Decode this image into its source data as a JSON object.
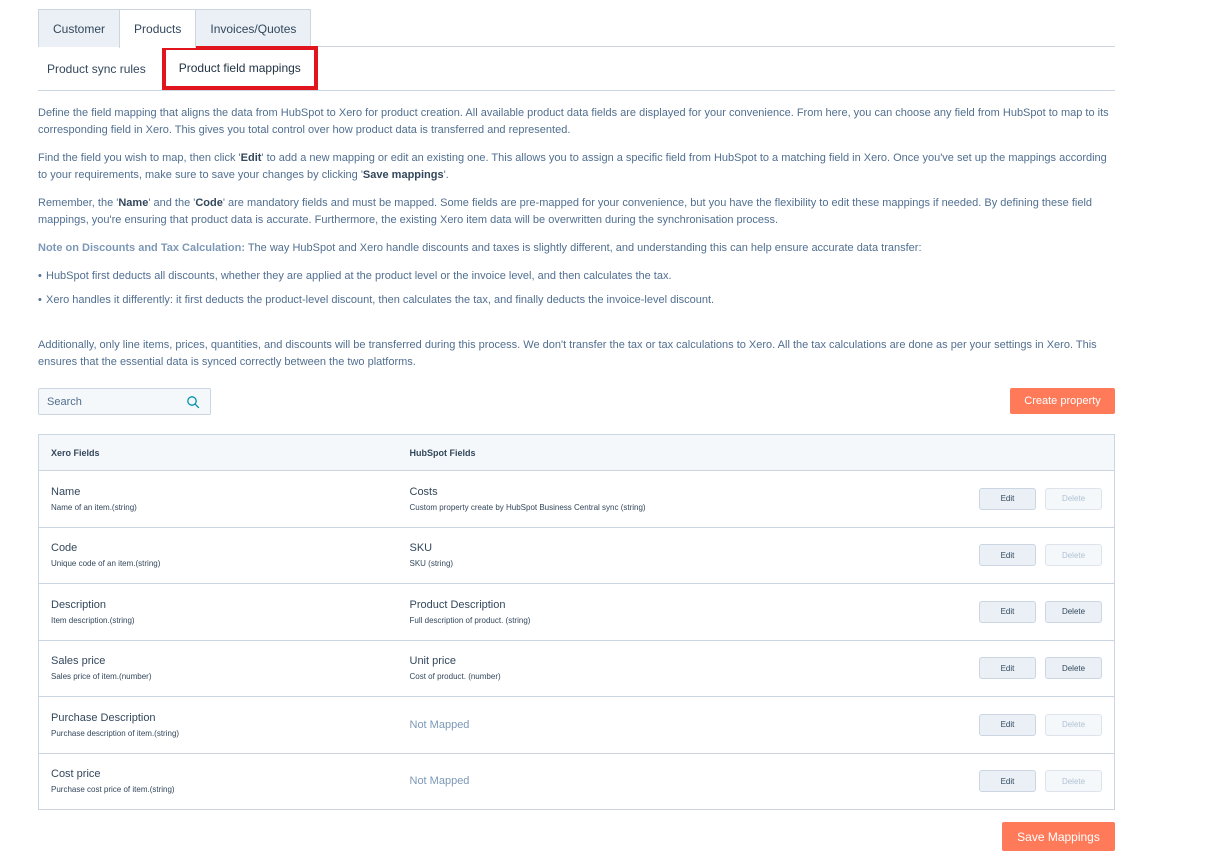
{
  "top_tabs": [
    {
      "label": "Customer",
      "active": false
    },
    {
      "label": "Products",
      "active": true
    },
    {
      "label": "Invoices/Quotes",
      "active": false
    }
  ],
  "sub_tabs": [
    {
      "label": "Product sync rules",
      "active": false
    },
    {
      "label": "Product field mappings",
      "active": true
    }
  ],
  "description": {
    "p1": "Define the field mapping that aligns the data from HubSpot to Xero for product creation. All available product data fields are displayed for your convenience. From here, you can choose any field from HubSpot to map to its corresponding field in Xero. This gives you total control over how product data is transferred and represented.",
    "p2_a": "Find the field you wish to map, then click '",
    "p2_edit": "Edit",
    "p2_b": "' to add a new mapping or edit an existing one. This allows you to assign a specific field from HubSpot to a matching field in Xero. Once you've set up the mappings according to your requirements, make sure to save your changes by clicking '",
    "p2_save": "Save mappings",
    "p2_c": "'.",
    "p3_a": "Remember, the '",
    "p3_name": "Name",
    "p3_b": "' and the '",
    "p3_code": "Code",
    "p3_c": "' are mandatory fields and must be mapped. Some fields are pre-mapped for your convenience, but you have the flexibility to edit these mappings if needed. By defining these field mappings, you're ensuring that product data is accurate.  Furthermore, the existing Xero item data will be overwritten during the synchronisation process.",
    "note_title": "Note on Discounts and Tax Calculation:",
    "note_text": " The way HubSpot and Xero handle discounts and taxes is slightly different, and understanding this can help ensure accurate data transfer:",
    "bullets": [
      "HubSpot first deducts all discounts, whether they are applied at the product level or the invoice level, and then calculates the tax.",
      "Xero handles it differently: it first deducts the product-level discount, then calculates the tax, and finally deducts the invoice-level discount."
    ],
    "p4": "Additionally, only line items, prices, quantities, and discounts will be transferred during this process. We don't transfer the tax or tax calculations to Xero. All the tax calculations are done as per your settings in Xero. This ensures that the essential data is synced correctly between the two platforms."
  },
  "search": {
    "placeholder": "Search",
    "icon": "search-icon"
  },
  "create_button": "Create property",
  "table": {
    "headers": {
      "xero": "Xero Fields",
      "hubspot": "HubSpot Fields"
    },
    "rows": [
      {
        "xero_name": "Name",
        "xero_desc": "Name of an item.(string)",
        "hubspot_name": "Costs",
        "hubspot_desc": "Custom property create by HubSpot Business Central sync (string)",
        "mapped": true,
        "edit": "Edit",
        "delete": "Delete",
        "delete_enabled": false
      },
      {
        "xero_name": "Code",
        "xero_desc": "Unique code of an item.(string)",
        "hubspot_name": "SKU",
        "hubspot_desc": "SKU (string)",
        "mapped": true,
        "edit": "Edit",
        "delete": "Delete",
        "delete_enabled": false
      },
      {
        "xero_name": "Description",
        "xero_desc": "Item description.(string)",
        "hubspot_name": "Product Description",
        "hubspot_desc": "Full description of product. (string)",
        "mapped": true,
        "edit": "Edit",
        "delete": "Delete",
        "delete_enabled": true
      },
      {
        "xero_name": "Sales price",
        "xero_desc": "Sales price of item.(number)",
        "hubspot_name": "Unit price",
        "hubspot_desc": "Cost of product. (number)",
        "mapped": true,
        "edit": "Edit",
        "delete": "Delete",
        "delete_enabled": true
      },
      {
        "xero_name": "Purchase Description",
        "xero_desc": "Purchase description of item.(string)",
        "hubspot_name": "Not Mapped",
        "hubspot_desc": "",
        "mapped": false,
        "edit": "Edit",
        "delete": "Delete",
        "delete_enabled": false
      },
      {
        "xero_name": "Cost price",
        "xero_desc": "Purchase cost price of item.(string)",
        "hubspot_name": "Not Mapped",
        "hubspot_desc": "",
        "mapped": false,
        "edit": "Edit",
        "delete": "Delete",
        "delete_enabled": false
      }
    ]
  },
  "save_button": "Save Mappings",
  "colors": {
    "accent": "#ff7a59",
    "highlight_border": "#e0151d",
    "text": "#33475b",
    "muted": "#516f90"
  }
}
